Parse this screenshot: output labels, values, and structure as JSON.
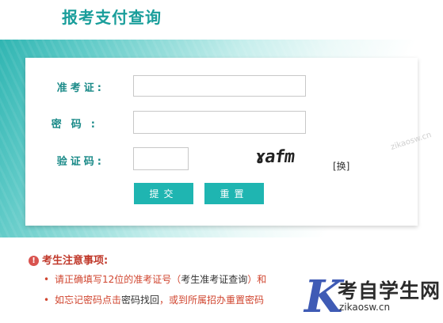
{
  "page": {
    "title": "报考支付查询"
  },
  "form": {
    "ticket_label": "准考证:",
    "ticket_value": "",
    "password_label": "密码:",
    "password_value": "",
    "captcha_label": "验证码:",
    "captcha_value": "",
    "captcha_text": "ɤafm",
    "refresh_label": "[换]",
    "submit_label": "提交",
    "reset_label": "重置"
  },
  "notice": {
    "title": "考生注意事项:",
    "item1_a": "请正确填写12位的准考证号（",
    "item1_link": "考生准考证查询",
    "item1_b": "）和",
    "item2_a": "如忘记密码点击",
    "item2_link": "密码找回",
    "item2_b": "，或到所属招办重置密码"
  },
  "watermark": {
    "letter": "K",
    "text": "考自学生网",
    "url": "zikaosw.cn",
    "faint": "zikaosw.cn"
  },
  "colors": {
    "accent": "#1fb5b1",
    "title": "#1a9e9b",
    "notice": "#d0452f",
    "watermark_blue": "#3f5bb5"
  }
}
